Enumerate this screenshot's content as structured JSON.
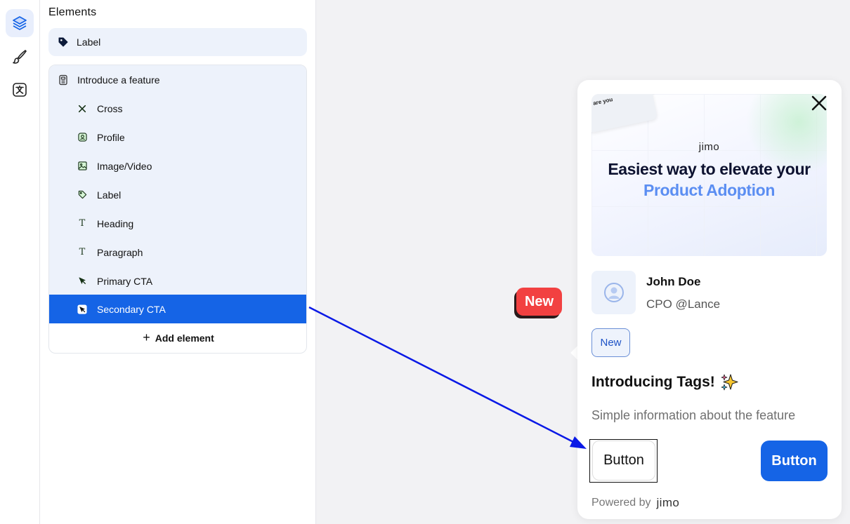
{
  "sidebar": {
    "title": "Elements",
    "label_block": {
      "label": "Label",
      "icon": "tag-filled-icon"
    },
    "group": {
      "label": "Introduce a feature",
      "icon": "card-icon",
      "items": [
        {
          "label": "Cross",
          "icon": "cross-icon"
        },
        {
          "label": "Profile",
          "icon": "profile-icon"
        },
        {
          "label": "Image/Video",
          "icon": "image-icon"
        },
        {
          "label": "Label",
          "icon": "tag-icon"
        },
        {
          "label": "Heading",
          "icon": "text-t-icon"
        },
        {
          "label": "Paragraph",
          "icon": "text-t-icon"
        },
        {
          "label": "Primary CTA",
          "icon": "cursor-icon"
        },
        {
          "label": "Secondary CTA",
          "icon": "cursor-box-icon",
          "selected": true
        }
      ],
      "add_label": "Add element"
    }
  },
  "rail": [
    {
      "icon": "layers-icon",
      "active": true
    },
    {
      "icon": "brush-icon",
      "active": false
    },
    {
      "icon": "translate-icon",
      "active": false
    }
  ],
  "badge": {
    "label": "New"
  },
  "card": {
    "hero": {
      "tile_text": "are you",
      "logo": "jimo",
      "line1": "Easiest way to elevate your",
      "line2": "Product Adoption"
    },
    "profile": {
      "name": "John Doe",
      "role": "CPO @Lance"
    },
    "tag": "New",
    "heading": "Introducing Tags!",
    "paragraph": "Simple information about the feature",
    "secondary_button": "Button",
    "primary_button": "Button",
    "powered_by": "Powered by",
    "powered_logo": "jimo"
  },
  "colors": {
    "accent": "#1564e6",
    "badge_red": "#f24141",
    "sidebar_bg": "#edf2fb",
    "hero_blue": "#5b8ef2",
    "arrow": "#0a19e6"
  }
}
